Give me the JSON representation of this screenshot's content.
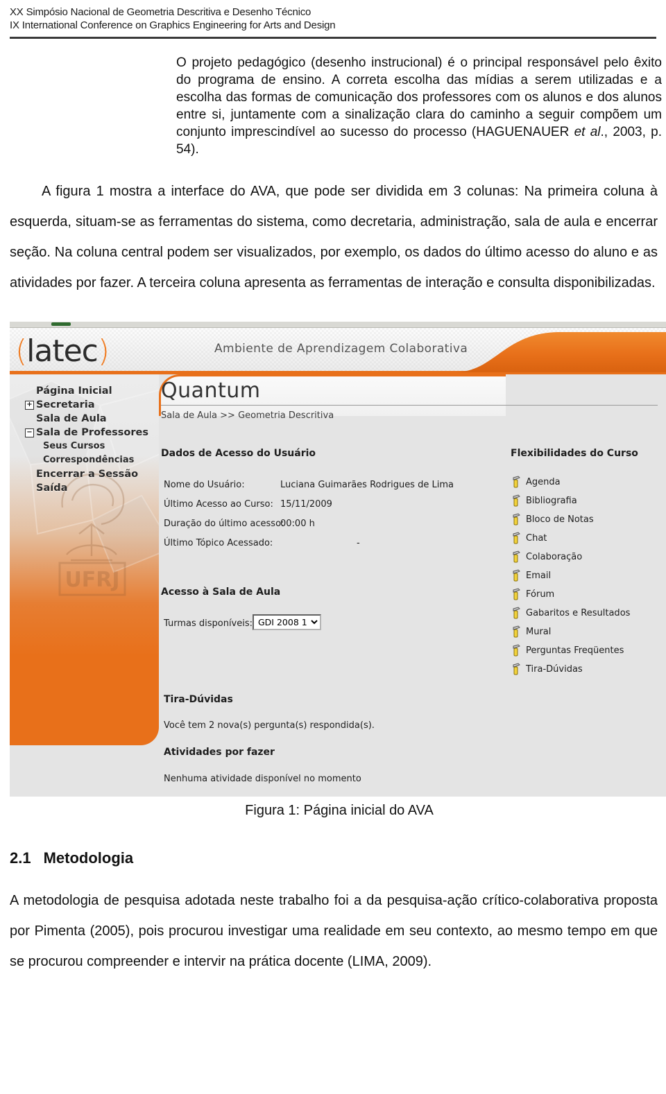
{
  "conference": {
    "line1": "XX Simpósio Nacional de Geometria Descritiva e Desenho Técnico",
    "line2": "IX International Conference on Graphics Engineering for Arts and Design"
  },
  "quote": {
    "part1": "O projeto pedagógico (desenho instrucional) é o principal responsável pelo êxito do programa de ensino. A correta escolha das mídias a serem utilizadas e a escolha das formas de comunicação dos professores com os alunos e dos alunos entre si, juntamente com a sinalização clara do caminho a seguir compõem um conjunto imprescindível ao sucesso do processo (HAGUENAUER ",
    "italic": "et al",
    "part2": "., 2003, p. 54)."
  },
  "paragraph1": "A figura 1 mostra a interface do AVA, que pode ser dividida em 3 colunas: Na primeira coluna à esquerda, situam-se as ferramentas do sistema, como decretaria, administração, sala de aula e encerrar seção. Na coluna central podem ser visualizados, por exemplo, os dados do último acesso do aluno e as atividades por fazer. A terceira coluna apresenta as ferramentas de interação e consulta disponibilizadas.",
  "figure": {
    "caption": "Figura 1: Página inicial do AVA",
    "colors": {
      "orange": "#e8701a",
      "panel_bg": "#e4e4e4",
      "banner_bg": "#f2f2f2"
    },
    "app": {
      "logo": "latec",
      "banner_title": "Ambiente de Aprendizagem Colaborativa",
      "app_title": "Quantum",
      "breadcrumb": "Sala de Aula >> Geometria Descritiva"
    },
    "sidebar": {
      "items": [
        {
          "label": "Página Inicial",
          "toggle": "",
          "sub": false
        },
        {
          "label": "Secretaria",
          "toggle": "+",
          "sub": false
        },
        {
          "label": "Sala de Aula",
          "toggle": "",
          "sub": false
        },
        {
          "label": "Sala de Professores",
          "toggle": "−",
          "sub": false
        },
        {
          "label": "Seus Cursos",
          "toggle": "",
          "sub": true
        },
        {
          "label": "Correspondências",
          "toggle": "",
          "sub": true
        },
        {
          "label": "Encerrar a Sessão",
          "toggle": "",
          "sub": false
        },
        {
          "label": "Saída",
          "toggle": "",
          "sub": false
        }
      ],
      "watermark": "UFRJ"
    },
    "center": {
      "section_access_title": "Dados de Acesso do Usuário",
      "fields": [
        {
          "label": "Nome do Usuário:",
          "value": "Luciana Guimarães Rodrigues de Lima"
        },
        {
          "label": "Último Acesso ao Curso:",
          "value": "15/11/2009"
        },
        {
          "label": "Duração do último acesso:",
          "value": "00:00 h"
        },
        {
          "label": "Último Tópico Acessado:",
          "value": "-"
        }
      ],
      "section_classroom_title": "Acesso à Sala de Aula",
      "classroom_label": "Turmas disponíveis:",
      "classroom_selected": "GDI 2008 1",
      "classroom_options": [
        "GDI 2008 1"
      ],
      "section_doubts_title": "Tira-Dúvidas",
      "doubts_text": "Você tem  2  nova(s) pergunta(s) respondida(s).",
      "section_activities_title": "Atividades por fazer",
      "activities_text": "Nenhuma atividade disponível no momento"
    },
    "right": {
      "title": "Flexibilidades do Curso",
      "tools": [
        "Agenda",
        "Bibliografia",
        "Bloco de Notas",
        "Chat",
        "Colaboração",
        "Email",
        "Fórum",
        "Gabaritos e Resultados",
        "Mural",
        "Perguntas Freqüentes",
        "Tira-Dúvidas"
      ]
    }
  },
  "section": {
    "number": "2.1",
    "title": "Metodologia",
    "body": "A metodologia de pesquisa adotada neste trabalho foi a da pesquisa-ação crítico-colaborativa proposta por Pimenta (2005), pois procurou investigar uma realidade em seu contexto, ao mesmo tempo em que se procurou compreender e intervir na prática docente (LIMA, 2009)."
  }
}
